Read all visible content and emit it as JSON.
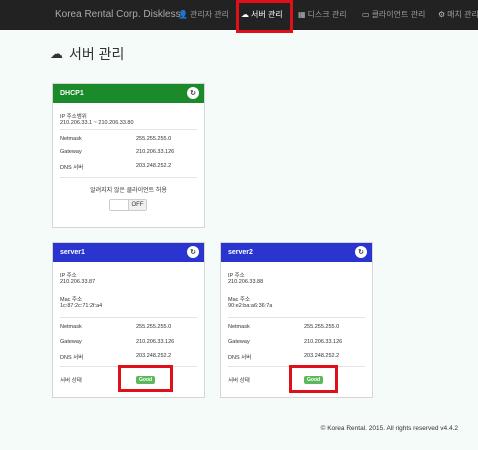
{
  "navbar": {
    "brand": "Korea Rental Corp. Diskless",
    "items": [
      {
        "label": "관리자 관리",
        "icon": "user-icon"
      },
      {
        "label": "서버 관리",
        "icon": "cloud-icon",
        "active": true
      },
      {
        "label": "디스크 관리",
        "icon": "disk-icon"
      },
      {
        "label": "클라이언트 관리",
        "icon": "monitor-icon"
      },
      {
        "label": "매치 관리",
        "icon": "gear-icon"
      }
    ]
  },
  "page": {
    "title": "서버 관리"
  },
  "dhcp": {
    "title": "DHCP1",
    "ip_range_label": "IP 주소범위",
    "ip_range": "210.206.33.1 ~ 210.206.33.80",
    "netmask_label": "Netmask",
    "netmask": "255.255.255.0",
    "gateway_label": "Gateway",
    "gateway": "210.206.33.126",
    "dns_label": "DNS 서버",
    "dns": "203.248.252.2",
    "unknown_label": "알려지지 않은 클라이언트 허용",
    "toggle_label": "OFF"
  },
  "servers": [
    {
      "title": "server1",
      "ip_label": "IP 주소",
      "ip": "210.206.33.87",
      "mac_label": "Mac 주소",
      "mac": "1c:87:2c:71:2f:a4",
      "netmask_label": "Netmask",
      "netmask": "255.255.255.0",
      "gateway_label": "Gateway",
      "gateway": "210.206.33.126",
      "dns_label": "DNS 서버",
      "dns": "203.248.252.2",
      "status_label": "서버 상태",
      "status": "Good"
    },
    {
      "title": "server2",
      "ip_label": "IP 주소",
      "ip": "210.206.33.88",
      "mac_label": "Mac 주소",
      "mac": "90:e2:ba:a6:36:7a",
      "netmask_label": "Netmask",
      "netmask": "255.255.255.0",
      "gateway_label": "Gateway",
      "gateway": "210.206.33.126",
      "dns_label": "DNS 서버",
      "dns": "203.248.252.2",
      "status_label": "서버 상태",
      "status": "Good"
    }
  ],
  "footer": {
    "text": "© Korea Rental. 2015. All rights reserved v4.4.2"
  },
  "colors": {
    "dhcp_header": "#1a8a2a",
    "server_header": "#2a35d0",
    "status_good": "#5cb85c",
    "highlight": "#e0101a"
  }
}
